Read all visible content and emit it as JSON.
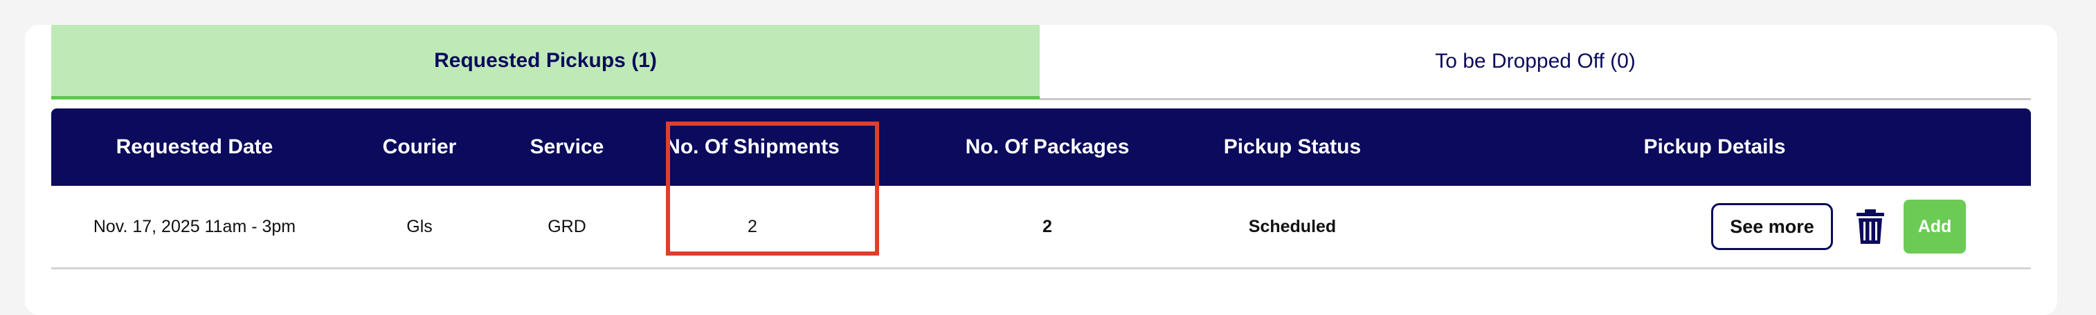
{
  "tabs": [
    {
      "label": "Requested Pickups (1)",
      "active": true
    },
    {
      "label": "To be Dropped Off (0)",
      "active": false
    }
  ],
  "table": {
    "headers": [
      "Requested Date",
      "Courier",
      "Service",
      "No. Of Shipments",
      "No. Of Packages",
      "Pickup Status",
      "Pickup Details"
    ],
    "rows": [
      {
        "requested_date": "Nov. 17, 2025 11am - 3pm",
        "courier": "Gls",
        "service": "GRD",
        "shipments": "2",
        "packages": "2",
        "status": "Scheduled",
        "see_more_label": "See more",
        "delete_icon": "trash-icon",
        "add_label": "Add"
      }
    ]
  },
  "highlight": {
    "target_column": "No. Of Shipments",
    "color": "#e03e2b"
  },
  "colors": {
    "header_bg": "#0b0a5c",
    "active_tab_bg": "#bfeab8",
    "active_tab_underline": "#5dc84a",
    "add_button": "#6ccb55"
  }
}
